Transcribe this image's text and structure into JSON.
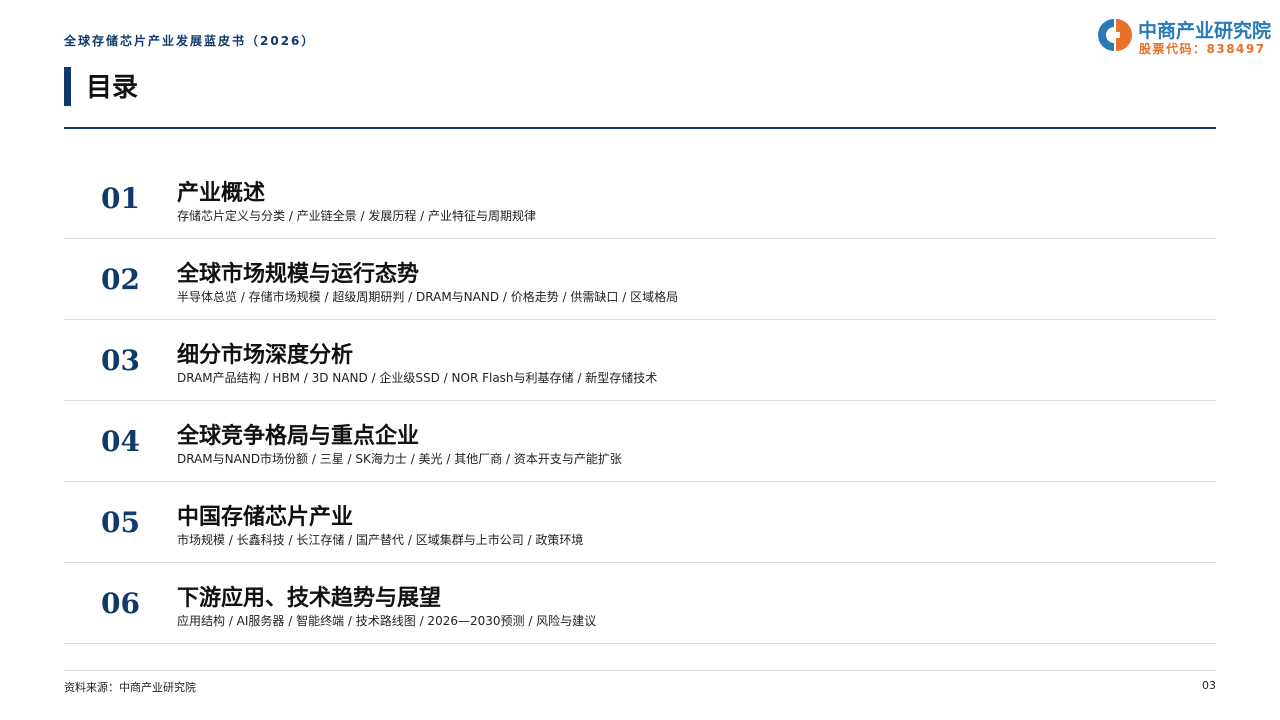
{
  "header": {
    "doc_title": "全球存储芯片产业发展蓝皮书（2026）",
    "page_title": "目录"
  },
  "logo": {
    "name": "中商产业研究院",
    "stock_code": "股票代码：838497",
    "colors": {
      "blue": "#2a7ab8",
      "orange": "#e8702a"
    }
  },
  "toc": [
    {
      "num": "01",
      "heading": "产业概述",
      "sub": "存储芯片定义与分类 / 产业链全景 / 发展历程 / 产业特征与周期规律"
    },
    {
      "num": "02",
      "heading": "全球市场规模与运行态势",
      "sub": "半导体总览 / 存储市场规模 / 超级周期研判 / DRAM与NAND / 价格走势 / 供需缺口 / 区域格局"
    },
    {
      "num": "03",
      "heading": "细分市场深度分析",
      "sub": "DRAM产品结构 / HBM / 3D NAND / 企业级SSD / NOR Flash与利基存储 / 新型存储技术"
    },
    {
      "num": "04",
      "heading": "全球竞争格局与重点企业",
      "sub": "DRAM与NAND市场份额 / 三星 / SK海力士 / 美光 / 其他厂商 / 资本开支与产能扩张"
    },
    {
      "num": "05",
      "heading": "中国存储芯片产业",
      "sub": "市场规模 / 长鑫科技 / 长江存储 / 国产替代 / 区域集群与上市公司 / 政策环境"
    },
    {
      "num": "06",
      "heading": "下游应用、技术趋势与展望",
      "sub": "应用结构 / AI服务器 / 智能终端 / 技术路线图 / 2026—2030预测 / 风险与建议"
    }
  ],
  "footer": {
    "source": "资料来源：中商产业研究院",
    "page_number": "03"
  },
  "colors": {
    "accent": "#0f3a6b",
    "divider": "#dddddd"
  }
}
